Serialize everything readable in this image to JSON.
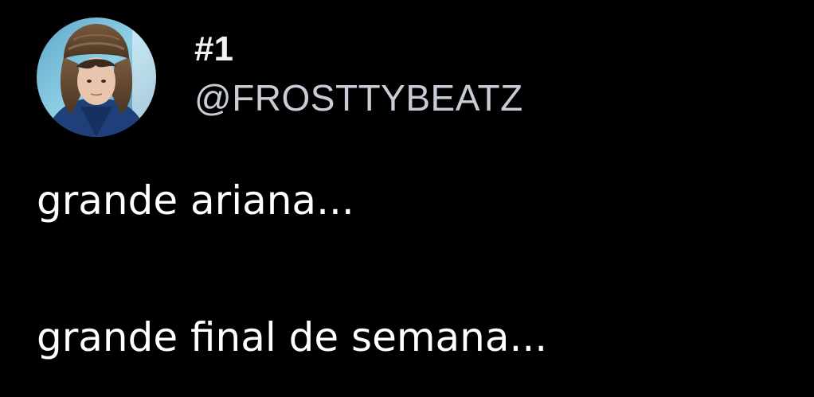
{
  "post": {
    "author": {
      "display_name": "#1",
      "handle": "@FROSTTYBEATZ",
      "avatar_icon": "profile-photo-avatar"
    },
    "text_lines": [
      "grande ariana...",
      "grande final de semana..."
    ]
  },
  "colors": {
    "background": "#000000",
    "display_name": "#f2f2f2",
    "handle": "#c8ccd6",
    "text": "#ffffff"
  }
}
